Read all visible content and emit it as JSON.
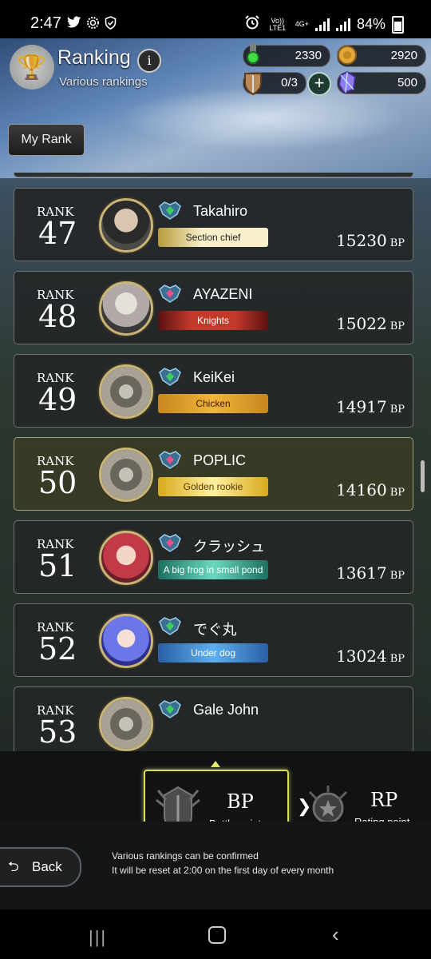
{
  "status_bar": {
    "time": "2:47",
    "volte": "Vo)) LTE1",
    "network": "4G+",
    "battery": "84%"
  },
  "header": {
    "title": "Ranking",
    "subtitle": "Various rankings",
    "info_glyph": "i",
    "my_rank_label": "My Rank"
  },
  "currencies": {
    "stamina": "2330",
    "gold": "2920",
    "tickets": "0/3",
    "gems": "500",
    "plus_glyph": "+"
  },
  "ranking": {
    "rank_word": "RANK",
    "bp_unit": "BP",
    "rows": [
      {
        "rank": "47",
        "name": "Takahiro",
        "title": "Section chief",
        "bp": "15230",
        "badge_style": "gold-plain",
        "tier": "green"
      },
      {
        "rank": "48",
        "name": "AYAZENI",
        "title": "Knights",
        "bp": "15022",
        "badge_style": "red",
        "tier": "pink"
      },
      {
        "rank": "49",
        "name": "KeiKei",
        "title": "Chicken",
        "bp": "14917",
        "badge_style": "orange",
        "tier": "green"
      },
      {
        "rank": "50",
        "name": "POPLIC",
        "title": "Golden rookie",
        "bp": "14160",
        "badge_style": "gold",
        "tier": "pink",
        "highlighted": true
      },
      {
        "rank": "51",
        "name": "クラッシュ",
        "title": "A big frog in small pond",
        "bp": "13617",
        "badge_style": "teal",
        "tier": "pink"
      },
      {
        "rank": "52",
        "name": "でぐ丸",
        "title": "Under dog",
        "bp": "13024",
        "badge_style": "blue",
        "tier": "green"
      },
      {
        "rank": "53",
        "name": "Gale John",
        "title": "",
        "bp": "",
        "badge_style": "none",
        "tier": "green",
        "partial": true
      }
    ]
  },
  "tabs": {
    "bp": {
      "abbr": "BP",
      "label": "Battle point",
      "selected": true
    },
    "rp": {
      "abbr": "RP",
      "label": "Rating point",
      "selected": false
    }
  },
  "footer": {
    "back_label": "Back",
    "notice_line1": "Various rankings can be confirmed",
    "notice_line2": "It will be reset at 2:00 on the first day of every month"
  },
  "colors": {
    "highlight_border": "#d9dd5b",
    "row_bg": "#242728",
    "row_highlight_bg": "#383c26"
  },
  "icons": [
    "twitter-icon",
    "gear-icon",
    "shield-check-icon",
    "alarm-icon",
    "signal-icon",
    "battery-icon",
    "trophy-icon",
    "info-icon",
    "plus-icon",
    "back-arrow-icon",
    "recent-apps-icon",
    "home-icon",
    "nav-back-icon"
  ]
}
